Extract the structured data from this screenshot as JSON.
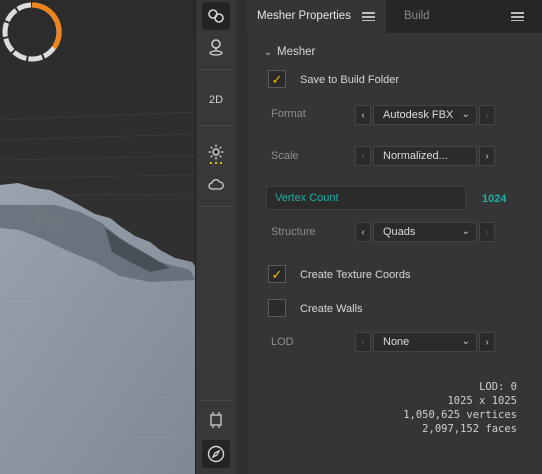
{
  "toolbar": {
    "items": [
      {
        "icon": "link-nodes-icon",
        "active": true
      },
      {
        "icon": "location-pin-icon",
        "active": false
      },
      {
        "label": "2D"
      },
      {
        "icon": "sun-icon"
      },
      {
        "icon": "cloud-icon"
      },
      {
        "icon": "frame-icon"
      },
      {
        "icon": "compass-icon",
        "active": true
      }
    ],
    "label_2d": "2D",
    "accent": "#e0c000"
  },
  "panel": {
    "tabs": [
      {
        "label": "Mesher Properties",
        "active": true
      },
      {
        "label": "Build",
        "active": false
      }
    ],
    "section": "Mesher",
    "save_to_build_folder": {
      "label": "Save to Build Folder",
      "checked": true
    },
    "format": {
      "label": "Format",
      "value": "Autodesk FBX"
    },
    "scale": {
      "label": "Scale",
      "value": "Normalized..."
    },
    "vertex_count": {
      "label": "Vertex Count",
      "value": "1024"
    },
    "structure": {
      "label": "Structure",
      "value": "Quads"
    },
    "create_texture_coords": {
      "label": "Create Texture Coords",
      "checked": true
    },
    "create_walls": {
      "label": "Create Walls",
      "checked": false
    },
    "lod": {
      "label": "LOD",
      "value": "None"
    },
    "stats": {
      "lod": "LOD: 0",
      "resolution": "1025 x 1025",
      "vertices": "1,050,625 vertices",
      "faces": "2,097,152 faces"
    }
  },
  "colors": {
    "accent_check": "#f0c000",
    "teal": "#1ab0a8",
    "progress": "#f0841c"
  }
}
